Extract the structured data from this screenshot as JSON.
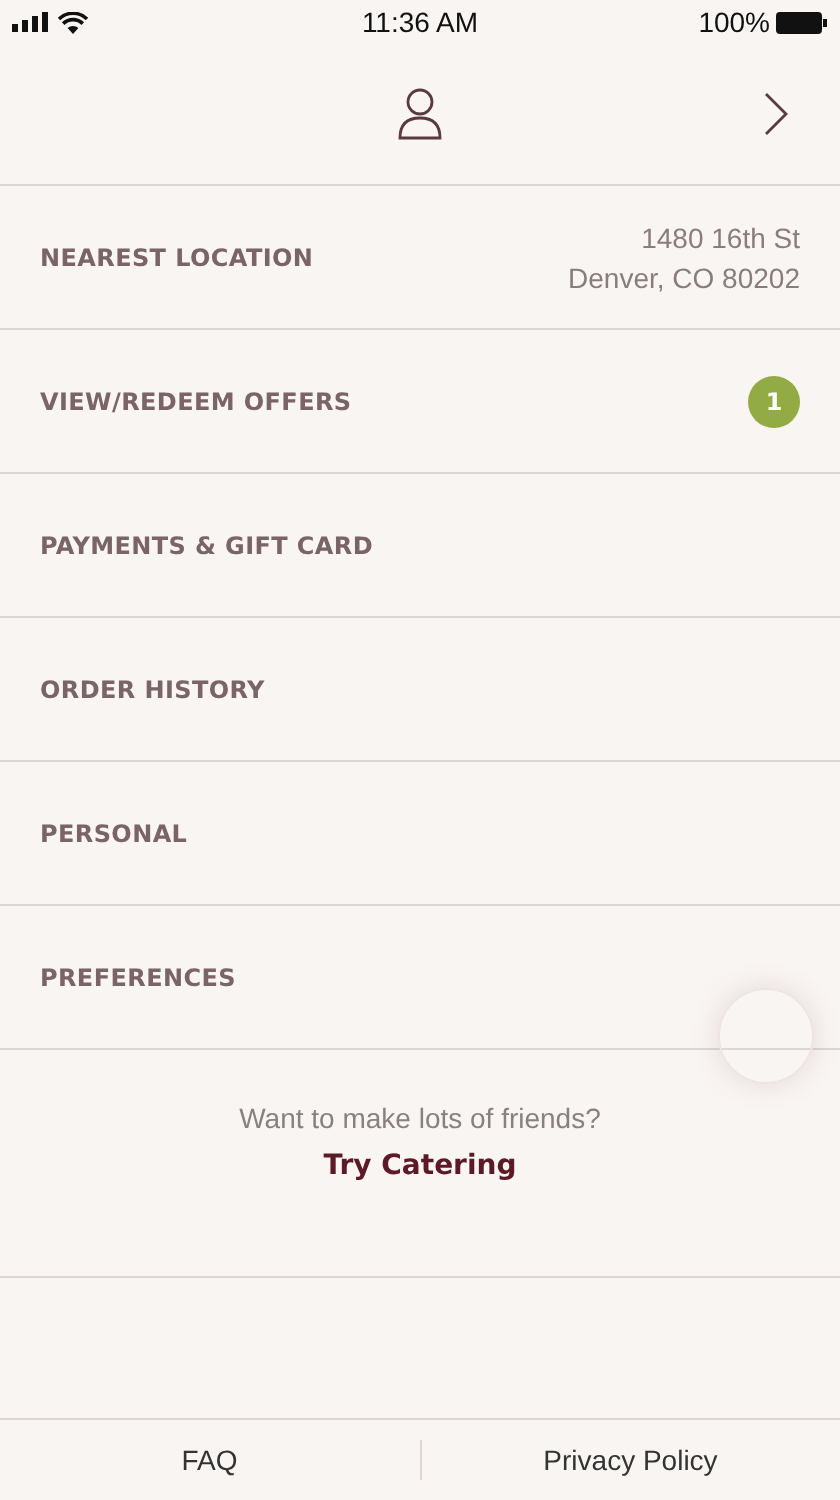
{
  "status_bar": {
    "time": "11:36 AM",
    "battery": "100%"
  },
  "menu": [
    {
      "label": "NEAREST LOCATION",
      "kind": "address",
      "lines": [
        "1480 16th St",
        "Denver, CO 80202"
      ]
    },
    {
      "label": "VIEW/REDEEM OFFERS",
      "kind": "badge",
      "badge": "1"
    },
    {
      "label": "PAYMENTS & GIFT CARD",
      "kind": "plain"
    },
    {
      "label": "ORDER HISTORY",
      "kind": "plain"
    },
    {
      "label": "PERSONAL",
      "kind": "plain"
    },
    {
      "label": "PREFERENCES",
      "kind": "plain"
    }
  ],
  "promo": {
    "question": "Want to make lots of friends?",
    "link": "Try Catering"
  },
  "footer": [
    "FAQ",
    "Privacy Policy"
  ]
}
